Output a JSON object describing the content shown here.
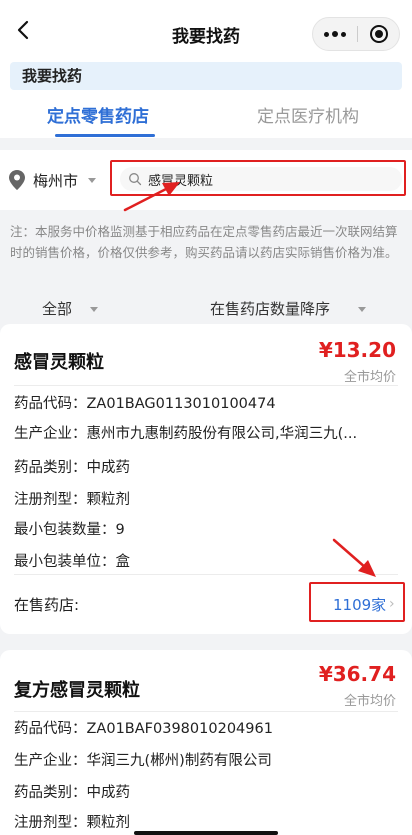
{
  "navbar": {
    "title": "我要找药",
    "back_icon": "chevron-left-icon",
    "more_icon": "more-dots-icon",
    "close_icon": "target-circle-icon"
  },
  "banner": {
    "title": "我要找药"
  },
  "tabs": [
    {
      "label": "定点零售药店",
      "active": true
    },
    {
      "label": "定点医疗机构",
      "active": false
    }
  ],
  "search": {
    "city": "梅州市",
    "query": "感冒灵颗粒",
    "icon": "search-icon",
    "location_icon": "location-pin-icon"
  },
  "notice": "注：本服务中价格监测基于相应药品在定点零售药店最近一次联网结算时的销售价格，价格仅供参考，购买药品请以药店实际销售价格为准。",
  "filters": {
    "category": "全部",
    "sort": "在售药店数量降序"
  },
  "results": [
    {
      "name": "感冒灵颗粒",
      "price": "¥13.20",
      "price_label": "全市均价",
      "fields": [
        {
          "label": "药品代码：",
          "value": "ZA01BAG0113010100474"
        },
        {
          "label": "生产企业：",
          "value": "惠州市九惠制药股份有限公司,华润三九(..."
        },
        {
          "label": "药品类别：",
          "value": "中成药"
        },
        {
          "label": "注册剂型：",
          "value": "颗粒剂"
        },
        {
          "label": "最小包装数量：",
          "value": "9"
        },
        {
          "label": "最小包装单位：",
          "value": "盒"
        }
      ],
      "stores_label": "在售药店:",
      "stores_count": "1109家"
    },
    {
      "name": "复方感冒灵颗粒",
      "price": "¥36.74",
      "price_label": "全市均价",
      "fields": [
        {
          "label": "药品代码：",
          "value": "ZA01BAF0398010204961"
        },
        {
          "label": "生产企业：",
          "value": "华润三九(郴州)制药有限公司"
        },
        {
          "label": "药品类别：",
          "value": "中成药"
        },
        {
          "label": "注册剂型：",
          "value": "颗粒剂"
        }
      ]
    }
  ],
  "colors": {
    "accent": "#2f6fd6",
    "price": "#e02020",
    "highlight": "#e02020"
  }
}
